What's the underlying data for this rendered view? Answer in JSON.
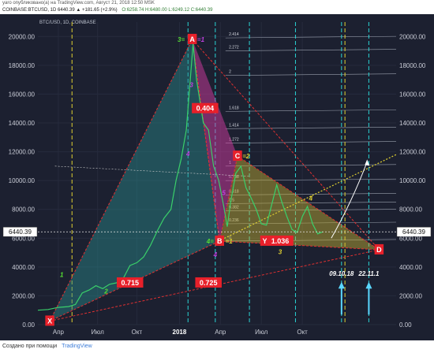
{
  "header": {
    "publisher": "yaro опубликовано(а) на TradingView.com, Август 21, 2018 12:50 MSK",
    "ticker": "COINBASE:BTCUSD, 1D  6440.39  ▲ +181.65 (+2.9%)",
    "ohlc": "O:6258.74 H:6480.00 L:6249.12 C:6440.39",
    "symbol_label": "BTC/USD, 1D, COINBASE"
  },
  "footer": {
    "help_text": "Создано при помощи",
    "brand": "TradingView"
  },
  "colors": {
    "background": "#1c2030",
    "triangle_left": "#2a8c8c",
    "triangle_mid": "#d23aa0",
    "triangle_right": "#c8b432",
    "label_red": "#e8202a",
    "yellow_dotted": "#e0d030",
    "cyan_dashed": "#2ad4d4"
  },
  "chart_data": {
    "type": "line",
    "title": "",
    "xlabel": "",
    "ylabel": "",
    "ylim": [
      0,
      21000
    ],
    "x_ticks": [
      "Апр",
      "Июл",
      "Окт",
      "2018",
      "Апр",
      "Июл",
      "Окт"
    ],
    "y_ticks": [
      "0.00",
      "2000.00",
      "4000.00",
      "6000.00",
      "8000.00",
      "10000.00",
      "12000.00",
      "14000.00",
      "16000.00",
      "18000.00",
      "20000.00"
    ],
    "current_price": "6440.39",
    "series": [
      {
        "values": [
          [
            0,
            1000
          ],
          [
            6,
            1050
          ],
          [
            12,
            1200
          ],
          [
            18,
            1250
          ],
          [
            22,
            1400
          ],
          [
            26,
            2200
          ],
          [
            30,
            2400
          ],
          [
            34,
            2700
          ],
          [
            38,
            2500
          ],
          [
            42,
            2800
          ],
          [
            46,
            2900
          ],
          [
            50,
            3200
          ],
          [
            54,
            4100
          ],
          [
            58,
            4300
          ],
          [
            62,
            4700
          ],
          [
            66,
            5500
          ],
          [
            70,
            6500
          ],
          [
            74,
            7400
          ],
          [
            78,
            8000
          ],
          [
            81,
            10000
          ],
          [
            84,
            11500
          ],
          [
            87,
            13500
          ],
          [
            89,
            16500
          ],
          [
            91,
            19500
          ],
          [
            93,
            17000
          ],
          [
            95,
            15500
          ],
          [
            97,
            14000
          ],
          [
            100,
            13500
          ],
          [
            103,
            11000
          ],
          [
            106,
            10000
          ],
          [
            109,
            8200
          ],
          [
            111,
            6800
          ],
          [
            113,
            8500
          ],
          [
            116,
            10500
          ],
          [
            119,
            11000
          ],
          [
            122,
            9500
          ],
          [
            125,
            8800
          ],
          [
            128,
            8000
          ],
          [
            131,
            7000
          ],
          [
            134,
            6900
          ],
          [
            137,
            8300
          ],
          [
            140,
            9700
          ],
          [
            143,
            8500
          ],
          [
            146,
            7500
          ],
          [
            149,
            6600
          ],
          [
            152,
            6400
          ],
          [
            155,
            7500
          ],
          [
            158,
            8200
          ],
          [
            161,
            7000
          ],
          [
            164,
            6300
          ],
          [
            167,
            6440
          ]
        ]
      }
    ],
    "pattern_points": [
      {
        "label": "X",
        "x": 7,
        "y": 250
      },
      {
        "label": "A",
        "x": 90.5,
        "y": 19800
      },
      {
        "label": "B",
        "x": 106.5,
        "y": 5800
      },
      {
        "label": "C",
        "x": 117,
        "y": 11700
      },
      {
        "label": "Y",
        "x": 133,
        "y": 5800
      },
      {
        "label": "D",
        "x": 200,
        "y": 5200
      }
    ],
    "ratios": [
      {
        "label": "0.404",
        "x": 98,
        "y": 15000
      },
      {
        "label": "1.036",
        "x": 142,
        "y": 5800
      },
      {
        "label": "0.715",
        "x": 54,
        "y": 2900
      },
      {
        "label": "0.725",
        "x": 100,
        "y": 2900
      }
    ],
    "wave_labels": [
      {
        "label": "1",
        "x": 14,
        "y": 3300,
        "color": "#55dd33"
      },
      {
        "label": "2",
        "x": 40,
        "y": 2150,
        "color": "#55dd33"
      },
      {
        "label": "3",
        "x": 90,
        "y": 16500,
        "color": "#c040e0"
      },
      {
        "label": "4",
        "x": 88,
        "y": 11700,
        "color": "#c040e0"
      },
      {
        "label": "4",
        "x": 160,
        "y": 8600,
        "color": "#e0d030"
      },
      {
        "label": "3",
        "x": 142,
        "y": 4900,
        "color": "#e0d030"
      },
      {
        "label": "4",
        "x": 104,
        "y": 4700,
        "color": "#c040e0"
      },
      {
        "label": "5",
        "x": 109,
        "y": 9000,
        "color": "#c040e0"
      }
    ],
    "point_tags": [
      {
        "label": "3= ",
        "x": 84,
        "y": 19800,
        "color": "#55dd33"
      },
      {
        "label": "=1",
        "x": 95.5,
        "y": 19800,
        "color": "#c040e0"
      },
      {
        "label": "4= ",
        "x": 101,
        "y": 5800,
        "color": "#55dd33"
      },
      {
        "label": "=1",
        "x": 112,
        "y": 5800,
        "color": "#e0d030"
      },
      {
        "label": "=2",
        "x": 122,
        "y": 11700,
        "color": "#e0d030"
      }
    ],
    "fib_levels": [
      {
        "label": "2.414",
        "y": 19900
      },
      {
        "label": "2.272",
        "y": 19000
      },
      {
        "label": "2",
        "y": 17300
      },
      {
        "label": "1.618",
        "y": 14800
      },
      {
        "label": "1.414",
        "y": 13600
      },
      {
        "label": "1.272",
        "y": 12600
      },
      {
        "label": "1",
        "y": 11000
      },
      {
        "label": "0.786",
        "y": 10000
      },
      {
        "label": "0.618",
        "y": 9000
      },
      {
        "label": "0.5",
        "y": 8400
      },
      {
        "label": "0.382",
        "y": 7900
      },
      {
        "label": "0.236",
        "y": 7000
      },
      {
        "label": "0",
        "y": 5800
      }
    ],
    "date_annotations": [
      {
        "label": "09.10.18",
        "x": 178
      },
      {
        "label": "22.11.1",
        "x": 194
      }
    ]
  }
}
